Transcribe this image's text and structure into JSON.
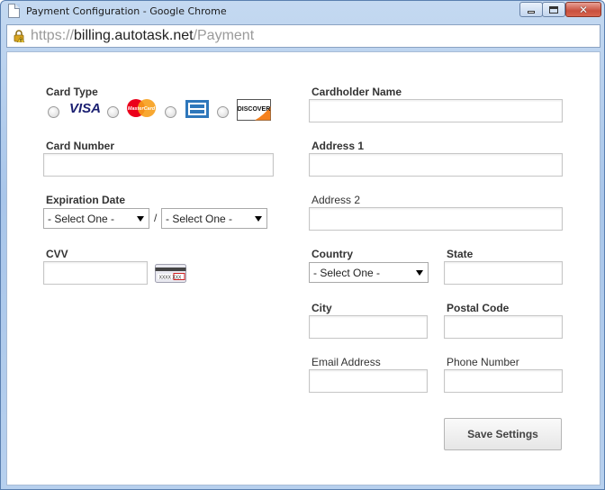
{
  "window": {
    "title": "Payment Configuration - Google Chrome"
  },
  "address_bar": {
    "scheme": "https://",
    "host": "billing.autotask.net",
    "path": "/Payment"
  },
  "form": {
    "card_type": {
      "label": "Card Type",
      "options": [
        {
          "name": "visa",
          "text": "VISA"
        },
        {
          "name": "mastercard",
          "text": "MasterCard"
        },
        {
          "name": "amex"
        },
        {
          "name": "discover",
          "text": "DISCOVER"
        }
      ]
    },
    "card_number_label": "Card Number",
    "expiration": {
      "label": "Expiration Date",
      "month_value": "- Select One -",
      "year_value": "- Select One -",
      "separator": "/"
    },
    "cvv": {
      "label": "CVV",
      "card_text": "XXXX XXX"
    },
    "cardholder_name_label": "Cardholder Name",
    "address1_label": "Address 1",
    "address2_label": "Address 2",
    "country": {
      "label": "Country",
      "value": "- Select One -"
    },
    "state_label": "State",
    "city_label": "City",
    "postal_code_label": "Postal Code",
    "email_label": "Email Address",
    "phone_label": "Phone Number",
    "save_label": "Save Settings"
  },
  "colors": {
    "visa_blue": "#1a1f71",
    "mastercard_red": "#eb001b",
    "mastercard_orange": "#f79e1b",
    "amex_blue": "#2e77bb",
    "discover_orange": "#f58220"
  }
}
